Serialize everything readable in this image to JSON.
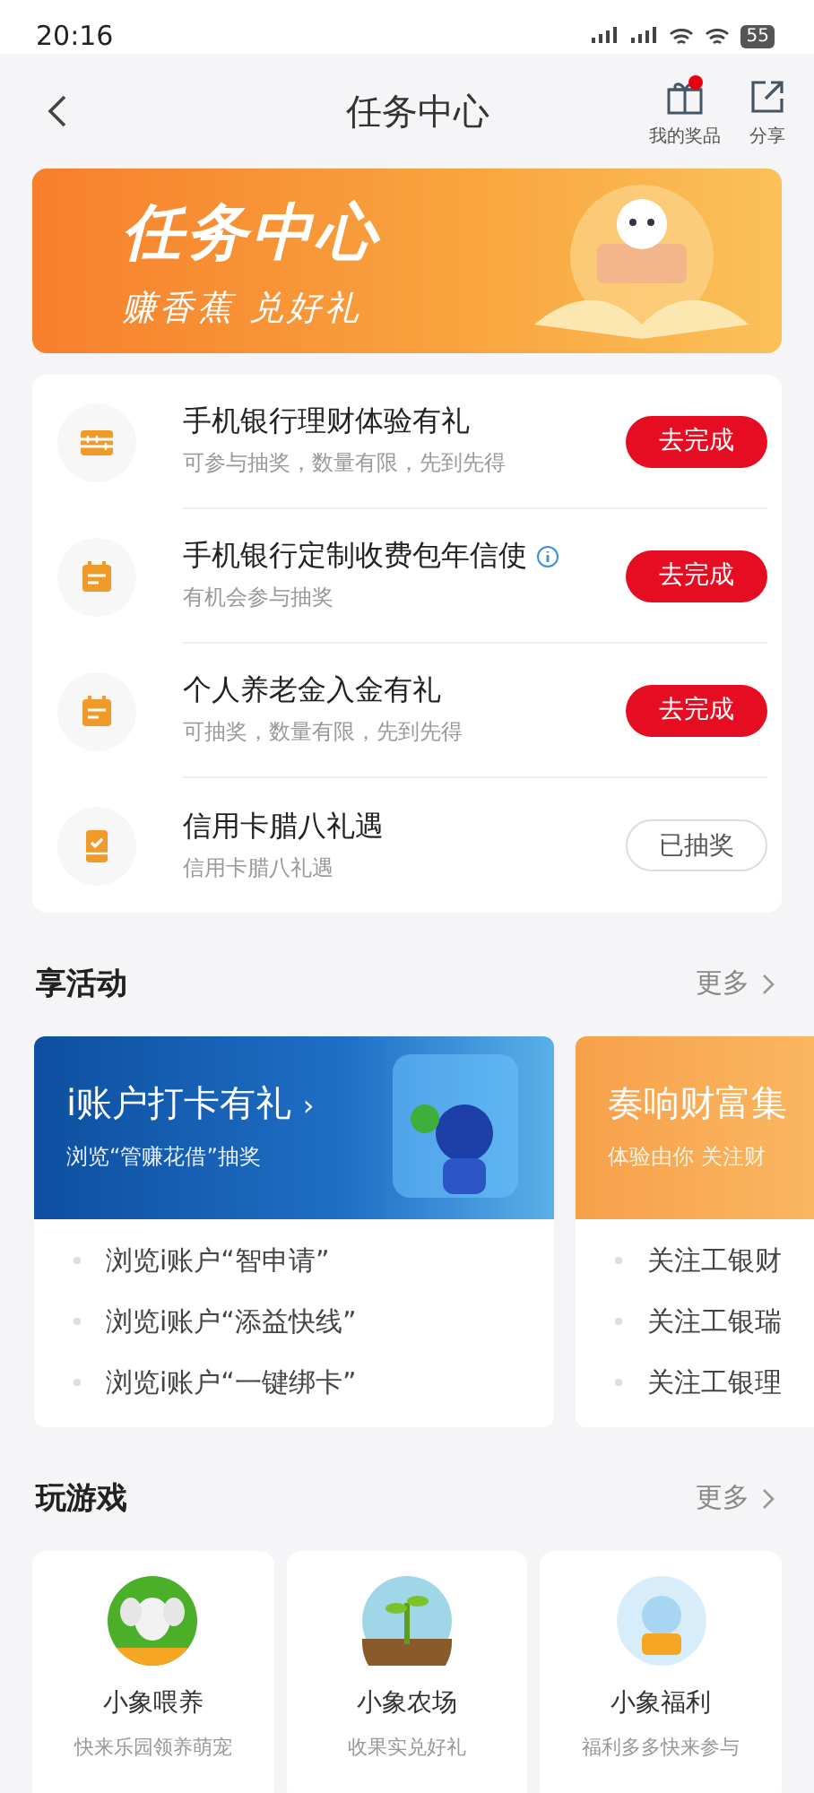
{
  "status_bar": {
    "time": "20:16",
    "battery": "55"
  },
  "nav": {
    "title": "任务中心",
    "actions": [
      {
        "label": "我的奖品",
        "kind": "gift",
        "badge": true
      },
      {
        "label": "分享",
        "kind": "share",
        "badge": false
      }
    ]
  },
  "banner": {
    "title": "任务中心",
    "subtitle": "赚香蕉 兑好礼"
  },
  "tasks": [
    {
      "title": "手机银行理财体验有礼",
      "subtitle": "可参与抽奖，数量有限，先到先得",
      "kind": "abacus",
      "info": false,
      "button": "去完成",
      "completed": false
    },
    {
      "title": "手机银行定制收费包年信使",
      "subtitle": "有机会参与抽奖",
      "kind": "calendar",
      "info": true,
      "button": "去完成",
      "completed": false
    },
    {
      "title": "个人养老金入金有礼",
      "subtitle": "可抽奖，数量有限，先到先得",
      "kind": "calendar",
      "info": false,
      "button": "去完成",
      "completed": false
    },
    {
      "title": "信用卡腊八礼遇",
      "subtitle": "信用卡腊八礼遇",
      "kind": "phone",
      "info": false,
      "button": "已抽奖",
      "completed": true
    }
  ],
  "activities": {
    "title": "享活动",
    "more": "更多",
    "cards": [
      {
        "title": "i账户打卡有礼",
        "arrow": "›",
        "subtitle": "浏览“管赚花借”抽奖",
        "kind": "blue",
        "items": [
          "浏览i账户“智申请”",
          "浏览i账户“添益快线”",
          "浏览i账户“一键绑卡”"
        ]
      },
      {
        "title": "奏响财富集",
        "subtitle": "体验由你 关注财",
        "kind": "orange",
        "items": [
          "关注工银财",
          "关注工银瑞",
          "关注工银理"
        ]
      }
    ]
  },
  "games": {
    "title": "玩游戏",
    "more": "更多",
    "cards": [
      {
        "name": "小象喂养",
        "desc": "快来乐园领养萌宠",
        "kind": "elephant"
      },
      {
        "name": "小象农场",
        "desc": "收果实兑好礼",
        "kind": "plant"
      },
      {
        "name": "小象福利",
        "desc": "福利多多快来参与",
        "kind": "mascot"
      }
    ]
  }
}
